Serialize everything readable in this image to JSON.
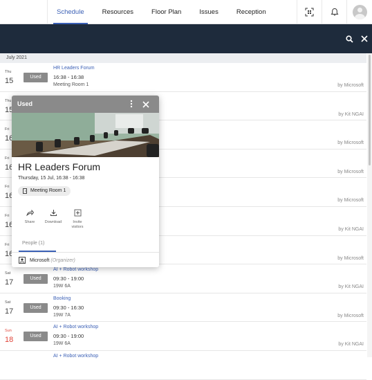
{
  "nav": {
    "tabs": [
      "Schedule",
      "Resources",
      "Floor Plan",
      "Issues",
      "Reception"
    ],
    "active_tab": "Schedule",
    "icons": [
      "qr-scan-icon",
      "bell-icon",
      "avatar"
    ]
  },
  "toolbar": {
    "icons": [
      "search-icon",
      "close-icon"
    ]
  },
  "month_label": "July 2021",
  "rows": [
    {
      "dow": "Thu",
      "day": "15",
      "status": "Used",
      "title": "HR Leaders Forum",
      "time": "16:38 - 16:38",
      "room": "Meeting Room 1",
      "owner": "by Microsoft",
      "sunday": false
    },
    {
      "dow": "Thu",
      "day": "15",
      "status": "",
      "title": "",
      "time": "",
      "room": "",
      "owner": "by Kit NGAI",
      "sunday": false
    },
    {
      "dow": "Fri",
      "day": "16",
      "status": "",
      "title": "",
      "time": "",
      "room": "",
      "owner": "by Microsoft",
      "sunday": false
    },
    {
      "dow": "Fri",
      "day": "16",
      "status": "",
      "title": "",
      "time": "",
      "room": "",
      "owner": "by Microsoft",
      "sunday": false
    },
    {
      "dow": "Fri",
      "day": "16",
      "status": "",
      "title": "",
      "time": "",
      "room": "",
      "owner": "by Microsoft",
      "sunday": false
    },
    {
      "dow": "Fri",
      "day": "16",
      "status": "",
      "title": "",
      "time": "",
      "room": "",
      "owner": "by Kit NGAI",
      "sunday": false
    },
    {
      "dow": "Fri",
      "day": "16",
      "status": "",
      "title": "",
      "time": "",
      "room": "",
      "owner": "by Microsoft",
      "sunday": false
    },
    {
      "dow": "Sat",
      "day": "17",
      "status": "Used",
      "title": "AI + Robot workshop",
      "time": "09:30 - 19:00",
      "room": "19W 6A",
      "owner": "by Kit NGAI",
      "sunday": false
    },
    {
      "dow": "Sat",
      "day": "17",
      "status": "Used",
      "title": "Booking",
      "time": "09:30 - 16:30",
      "room": "19W 7A",
      "owner": "by Microsoft",
      "sunday": false
    },
    {
      "dow": "Sun",
      "day": "18",
      "status": "Used",
      "title": "AI + Robot workshop",
      "time": "09:30 - 19:00",
      "room": "19W 6A",
      "owner": "by Kit NGAI",
      "sunday": true
    },
    {
      "dow": "",
      "day": "",
      "status": "",
      "title": "AI + Robot workshop",
      "time": "",
      "room": "",
      "owner": "",
      "sunday": false
    }
  ],
  "popup": {
    "status": "Used",
    "title": "HR Leaders Forum",
    "when": "Thursday, 15 Jul, 16:38 - 16:38",
    "room": "Meeting Room 1",
    "actions": [
      {
        "label": "Share",
        "icon": "share-icon"
      },
      {
        "label": "Download",
        "icon": "download-icon"
      },
      {
        "label": "Invite visitors",
        "icon": "add-box-icon"
      }
    ],
    "people_tab": "People (1)",
    "organizer_name": "Microsoft",
    "organizer_role": "(Organizer)"
  },
  "colors": {
    "accent": "#3a5fb5",
    "toolbar_bg": "#1e2b3c",
    "badge_bg": "#8a8a8a",
    "sunday": "#e0453a"
  }
}
